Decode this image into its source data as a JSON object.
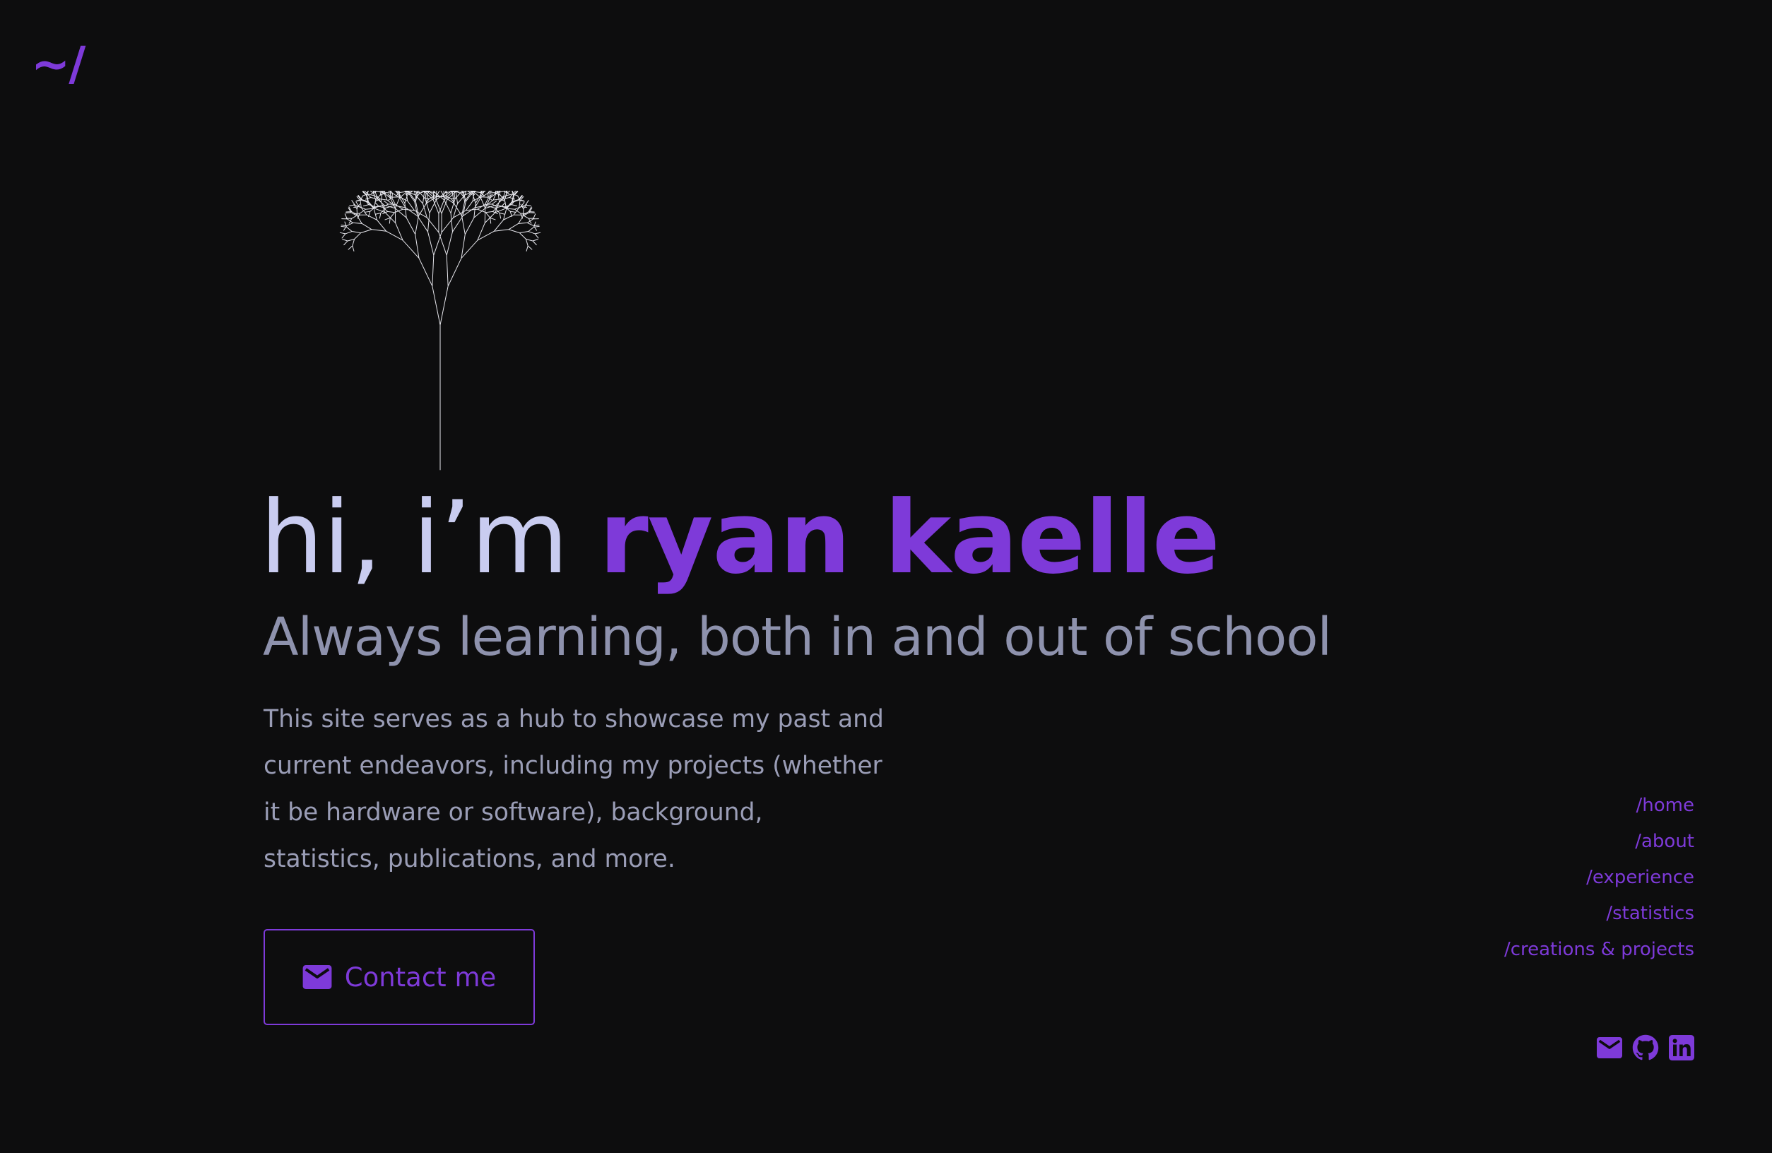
{
  "header": {
    "logo_text": "~/"
  },
  "hero": {
    "greeting": "hi, i’m ",
    "name": "ryan kaelle",
    "subtitle": "Always learning, both in and out of school",
    "intro": "This site serves as a hub to showcase my past and current endeavors, including my projects (whether it be hardware or software), background, statistics, publications, and more.",
    "contact_label": "Contact me",
    "contact_icon": "mail-icon"
  },
  "nav": {
    "items": [
      {
        "label": "/home"
      },
      {
        "label": "/about"
      },
      {
        "label": "/experience"
      },
      {
        "label": "/statistics"
      },
      {
        "label": "/creations & projects"
      }
    ]
  },
  "socials": {
    "icons": [
      "mail-icon",
      "github-icon",
      "linkedin-icon"
    ]
  },
  "colors": {
    "background": "#0d0d0e",
    "accent": "#7e3ad9",
    "heading": "#c9ccf0",
    "subtitle": "#8e92ad",
    "body_text": "#9a9db6",
    "tree": "#e8e8ee"
  }
}
